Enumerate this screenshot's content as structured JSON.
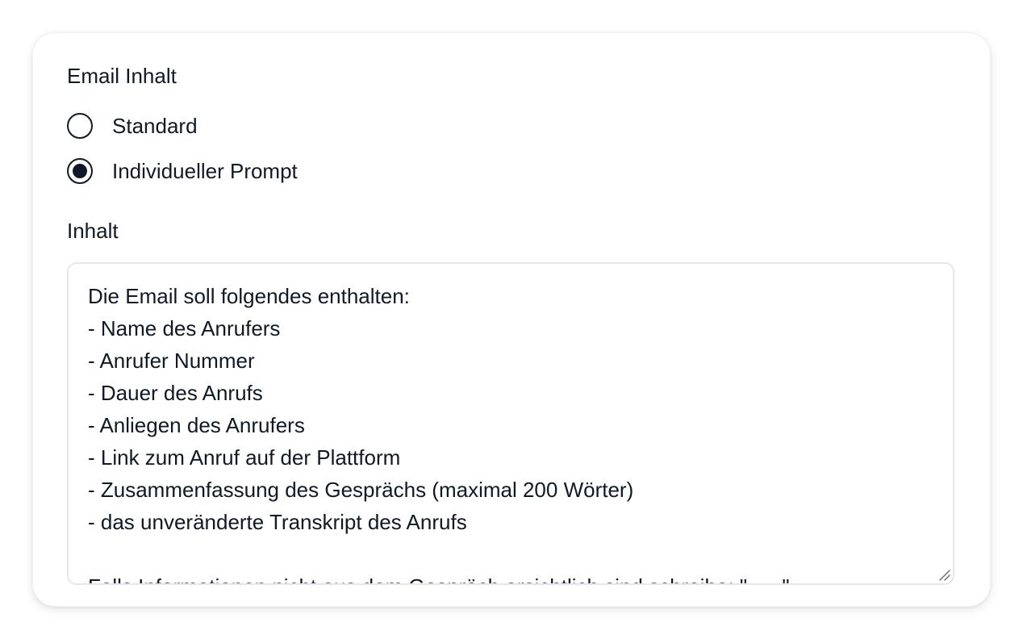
{
  "email_section": {
    "label": "Email Inhalt",
    "options": [
      {
        "label": "Standard",
        "checked": false
      },
      {
        "label": "Individueller Prompt",
        "checked": true
      }
    ]
  },
  "content_section": {
    "label": "Inhalt",
    "textarea_value": "Die Email soll folgendes enthalten:\n- Name des Anrufers\n- Anrufer Nummer\n- Dauer des Anrufs\n- Anliegen des Anrufers\n- Link zum Anruf auf der Plattform\n- Zusammenfassung des Gesprächs (maximal 200 Wörter)\n- das unveränderte Transkript des Anrufs\n\nFalls Informationen nicht aus dem Gespräch ersichtlich sind schreibe: \"___\""
  },
  "icons": {
    "resize": "resize-handle-icon"
  },
  "colors": {
    "text": "#111827",
    "border": "#e5e7eb"
  }
}
